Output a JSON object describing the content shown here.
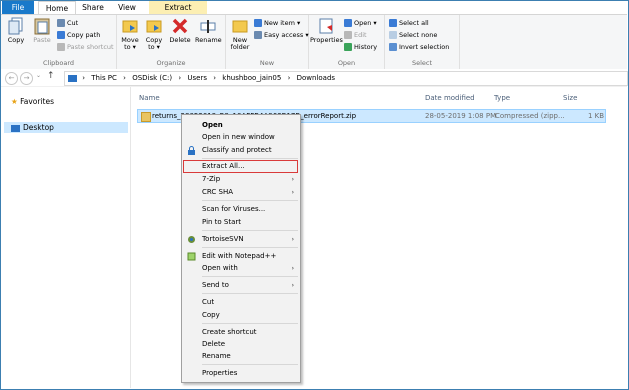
{
  "tabs": {
    "file": "File",
    "home": "Home",
    "share": "Share",
    "view": "View",
    "extract": "Extract"
  },
  "ribbon": {
    "clipboard": {
      "copy": "Copy",
      "paste": "Paste",
      "cut": "Cut",
      "copy_path": "Copy path",
      "paste_shortcut": "Paste shortcut",
      "label": "Clipboard"
    },
    "organize": {
      "move_to": "Move to ▾",
      "copy_to": "Copy to ▾",
      "delete": "Delete",
      "rename": "Rename",
      "label": "Organize"
    },
    "new": {
      "new_folder": "New folder",
      "new_item": "New item ▾",
      "easy_access": "Easy access ▾",
      "label": "New"
    },
    "open": {
      "properties": "Properties",
      "open": "Open ▾",
      "edit": "Edit",
      "history": "History",
      "label": "Open"
    },
    "select": {
      "select_all": "Select all",
      "select_none": "Select none",
      "invert": "Invert selection",
      "label": "Select"
    }
  },
  "address": {
    "parts": [
      "This PC",
      "OSDisk (C:)",
      "Users",
      "khushboo_jain05",
      "Downloads"
    ],
    "sep": "›"
  },
  "nav_pane": {
    "favorites": "Favorites",
    "desktop": "Desktop"
  },
  "columns": {
    "name": "Name",
    "date": "Date modified",
    "type": "Type",
    "size": "Size"
  },
  "file": {
    "name": "returns_28052019_R9_10AFFB4A963B17B_errorReport.zip",
    "date": "28-05-2019 1:08 PM",
    "type": "Compressed (zipp...",
    "size": "1 KB"
  },
  "context_menu": {
    "open": "Open",
    "open_new_window": "Open in new window",
    "classify": "Classify and protect",
    "extract_all": "Extract All...",
    "seven_zip": "7-Zip",
    "crc_sha": "CRC SHA",
    "scan": "Scan for Viruses...",
    "pin": "Pin to Start",
    "tortoise": "TortoiseSVN",
    "notepad": "Edit with Notepad++",
    "open_with": "Open with",
    "send_to": "Send to",
    "cut": "Cut",
    "copy": "Copy",
    "create_shortcut": "Create shortcut",
    "delete": "Delete",
    "rename": "Rename",
    "properties": "Properties",
    "arrow": "›"
  }
}
